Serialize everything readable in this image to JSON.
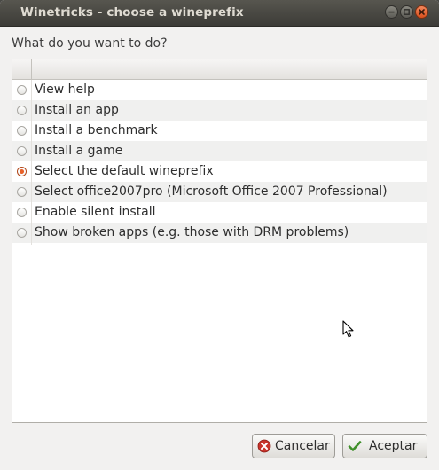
{
  "window": {
    "title": "Winetricks - choose a wineprefix"
  },
  "prompt": {
    "question": "What do you want to do?"
  },
  "options": [
    {
      "label": "View help",
      "selected": false
    },
    {
      "label": "Install an app",
      "selected": false
    },
    {
      "label": "Install a benchmark",
      "selected": false
    },
    {
      "label": "Install a game",
      "selected": false
    },
    {
      "label": "Select the default wineprefix",
      "selected": true
    },
    {
      "label": "Select office2007pro (Microsoft Office 2007 Professional)",
      "selected": false
    },
    {
      "label": "Enable silent install",
      "selected": false
    },
    {
      "label": "Show broken apps (e.g. those with DRM problems)",
      "selected": false
    }
  ],
  "buttons": {
    "cancel_label": "Cancelar",
    "cancel_icon": "cancel-x-icon",
    "accept_label": "Aceptar",
    "accept_icon": "checkmark-icon"
  },
  "colors": {
    "titlebar": "#3c3b37",
    "selected_radio": "#e8612a",
    "close_button": "#d8501d"
  }
}
